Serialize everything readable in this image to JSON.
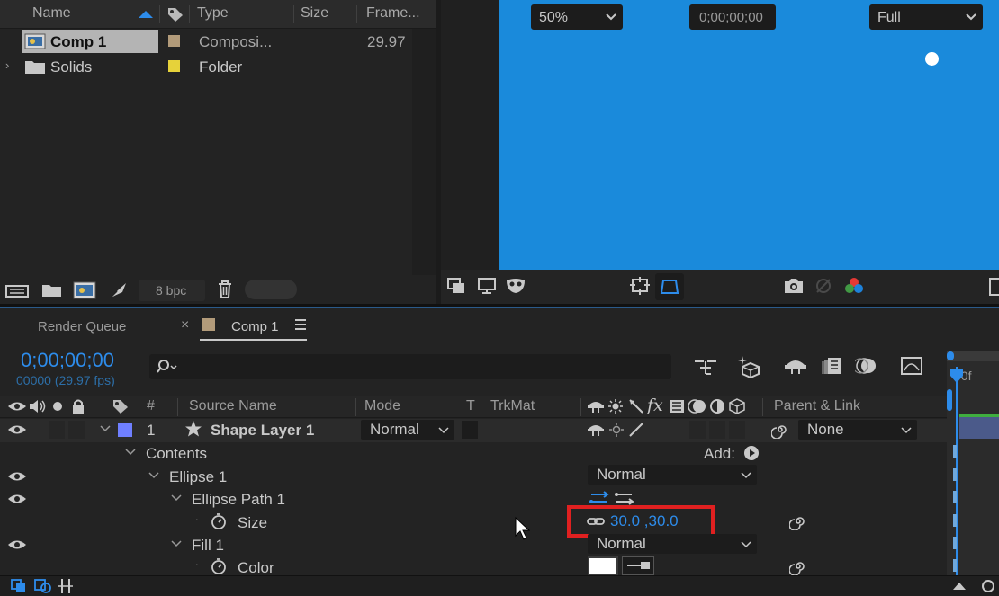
{
  "project": {
    "columns": {
      "name": "Name",
      "type": "Type",
      "size": "Size",
      "frame_rate": "Frame..."
    },
    "items": [
      {
        "name": "Comp 1",
        "type": "Composi...",
        "frame_rate": "29.97",
        "label_color": "#b29b7a",
        "selected": true
      },
      {
        "name": "Solids",
        "type": "Folder",
        "frame_rate": "",
        "label_color": "#e6d23a",
        "selected": false
      }
    ],
    "footer": {
      "bpc": "8 bpc"
    }
  },
  "viewer": {
    "canvas_color": "#1a8adb",
    "zoom": "50%",
    "timecode": "0;00;00;00",
    "resolution": "Full"
  },
  "timeline": {
    "tabs": {
      "render_queue": "Render Queue",
      "comp": "Comp 1"
    },
    "current_time": "0;00;00;00",
    "frame_info": "00000 (29.97 fps)",
    "ruler_label": "00f",
    "columns": {
      "hash": "#",
      "source_name": "Source Name",
      "mode": "Mode",
      "t": "T",
      "trkmat": "TrkMat",
      "parent_link": "Parent & Link"
    },
    "layer": {
      "number": "1",
      "name": "Shape Layer 1",
      "mode": "Normal",
      "parent": "None",
      "label_color": "#6f7fff"
    },
    "contents_label": "Contents",
    "add_label": "Add:",
    "ellipse": {
      "label": "Ellipse 1",
      "mode": "Normal"
    },
    "ellipse_path": {
      "label": "Ellipse Path 1"
    },
    "size": {
      "label": "Size",
      "value": "30.0 ,30.0"
    },
    "fill": {
      "label": "Fill 1",
      "mode": "Normal"
    },
    "color": {
      "label": "Color",
      "swatch": "#ffffff"
    }
  },
  "highlight_color": "#e02020",
  "accent_color": "#2d8ceb"
}
